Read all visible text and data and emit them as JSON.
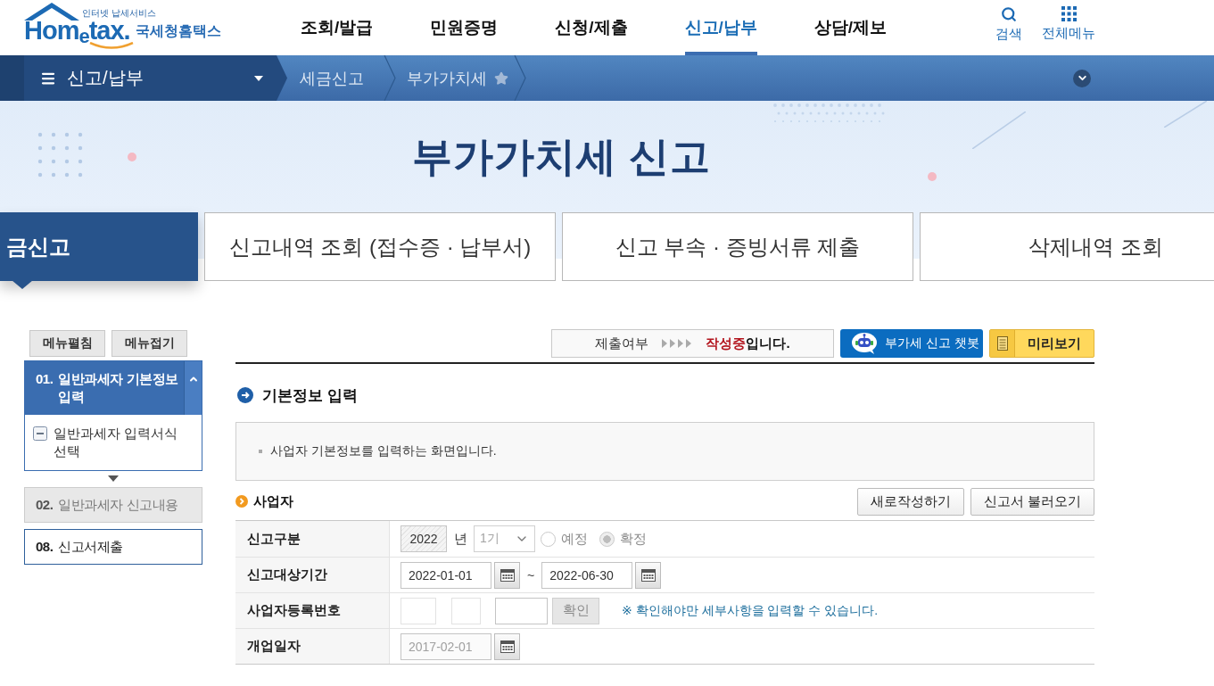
{
  "header": {
    "logo": {
      "tagline": "인터넷 납세서비스",
      "wordmark": "Hom$_{e}$tax.",
      "name": "국세청홈택스"
    },
    "nav": [
      {
        "label": "조회/발급",
        "selected": false
      },
      {
        "label": "민원증명",
        "selected": false
      },
      {
        "label": "신청/제출",
        "selected": false
      },
      {
        "label": "신고/납부",
        "selected": true
      },
      {
        "label": "상담/제보",
        "selected": false
      }
    ],
    "tools": [
      {
        "kind": "search",
        "label": "검색"
      },
      {
        "kind": "all_menu",
        "label": "전체메뉴"
      }
    ]
  },
  "location_bar": {
    "menu": "신고/납부",
    "breadcrumb": [
      "세금신고",
      "부가가치세"
    ],
    "favorite": false
  },
  "hero": {
    "title": "부가가치세 신고"
  },
  "tabs": [
    {
      "label": "금신고",
      "selected": true
    },
    {
      "label": "신고내역 조회 (접수증 · 납부서)",
      "selected": false
    },
    {
      "label": "신고 부속 · 증빙서류 제출",
      "selected": false
    },
    {
      "label": "삭제내역 조회",
      "selected": false
    }
  ],
  "sidebar": {
    "buttons": [
      "메뉴펼침",
      "메뉴접기"
    ],
    "steps": [
      {
        "number": "01.",
        "title": "일반과세자 기본정보 입력",
        "selected": true,
        "disabled": false,
        "expanded": true,
        "children": [
          {
            "label": "일반과세자 입력서식 선택"
          }
        ]
      },
      {
        "number": "02.",
        "title": "일반과세자 신고내용",
        "selected": false,
        "disabled": true,
        "expanded": false
      },
      {
        "number": "08.",
        "title": "신고서제출",
        "selected": false,
        "disabled": false,
        "expanded": false
      }
    ]
  },
  "toolbar": {
    "status": {
      "label": "제출여부",
      "value": "작성중",
      "suffix": "입니다."
    },
    "buttons": [
      {
        "kind": "chatbot",
        "label": "부가세 신고 챗봇"
      },
      {
        "kind": "preview",
        "label": "미리보기"
      }
    ]
  },
  "section": {
    "title": "기본정보 입력",
    "notice": "사업자 기본정보를 입력하는 화면입니다."
  },
  "business": {
    "title": "사업자",
    "buttons": [
      "새로작성하기",
      "신고서 불러오기"
    ],
    "rows": [
      {
        "label": "신고구분",
        "kind": "period",
        "disabled": true,
        "year": "2022",
        "year_unit": "년",
        "half": "1기",
        "options": [
          {
            "label": "예정",
            "selected": false
          },
          {
            "label": "확정",
            "selected": true
          }
        ]
      },
      {
        "label": "신고대상기간",
        "kind": "date_range",
        "disabled": false,
        "from": "2022-01-01",
        "separator": "~",
        "to": "2022-06-30"
      },
      {
        "label": "사업자등록번호",
        "kind": "business_number",
        "disabled": false,
        "button": {
          "label": "확인",
          "disabled": true
        },
        "note": "※ 확인해야만 세부사항을 입력할 수 있습니다."
      },
      {
        "label": "개업일자",
        "kind": "date",
        "disabled": true,
        "value": "2017-02-01"
      }
    ]
  }
}
